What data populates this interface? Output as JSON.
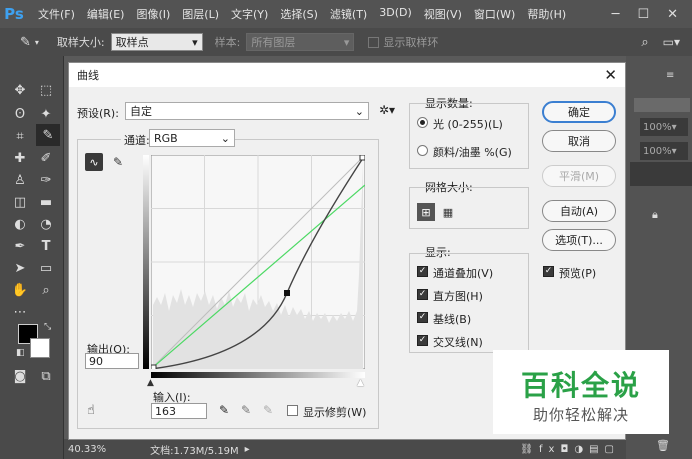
{
  "app": {
    "logo": "Ps"
  },
  "menubar": {
    "items": [
      "文件(F)",
      "编辑(E)",
      "图像(I)",
      "图层(L)",
      "文字(Y)",
      "选择(S)",
      "滤镜(T)",
      "3D(D)",
      "视图(V)",
      "窗口(W)",
      "帮助(H)"
    ]
  },
  "optbar": {
    "sample_size_label": "取样大小:",
    "sample_size_value": "取样点",
    "sample_label": "样本:",
    "sample_value": "所有图层",
    "show_ring": "显示取样环"
  },
  "right_panel": {
    "opacity1": "100%",
    "opacity2": "100%"
  },
  "status": {
    "zoom": "40.33%",
    "doc": "文档:1.73M/5.19M"
  },
  "dialog": {
    "title": "曲线",
    "preset_label": "预设(R):",
    "preset_value": "自定",
    "channel_label": "通道:",
    "channel_value": "RGB",
    "output_label": "输出(O):",
    "output_value": "90",
    "input_label": "输入(I):",
    "input_value": "163",
    "show_clipping": "显示修剪(W)",
    "show_amount": {
      "title": "显示数量:",
      "light": "光 (0-255)(L)",
      "pigment": "颜料/油墨 %(G)"
    },
    "grid_size": {
      "title": "网格大小:"
    },
    "show": {
      "title": "显示:",
      "channel_overlay": "通道叠加(V)",
      "histogram": "直方图(H)",
      "baseline": "基线(B)",
      "intersection": "交叉线(N)"
    },
    "buttons": {
      "ok": "确定",
      "cancel": "取消",
      "smooth": "平滑(M)",
      "auto": "自动(A)",
      "options": "选项(T)...",
      "preview": "预览(P)"
    }
  },
  "watermark": {
    "title": "百科全说",
    "subtitle": "助你轻松解决"
  },
  "colors": {
    "accent": "#3b7fd1",
    "watermark_green": "#2aa147",
    "curve_green": "#4cd964"
  }
}
